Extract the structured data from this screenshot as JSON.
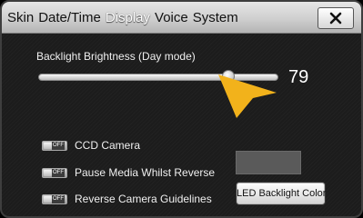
{
  "tabs": [
    {
      "label": "Skin",
      "active": false
    },
    {
      "label": "Date/Time",
      "active": false
    },
    {
      "label": "Display",
      "active": true
    },
    {
      "label": "Voice",
      "active": false
    },
    {
      "label": "System",
      "active": false
    }
  ],
  "close_icon": "close-x-icon",
  "backlight": {
    "label": "Backlight Brightness (Day mode)",
    "value": "79",
    "level_fraction": 0.79
  },
  "toggles": [
    {
      "label": "CCD Camera",
      "state": "OFF"
    },
    {
      "label": "Pause Media Whilst Reverse",
      "state": "OFF"
    },
    {
      "label": "Reverse Camera Guidelines",
      "state": "OFF"
    }
  ],
  "led_button_label": "LED Backlight Color",
  "colors": {
    "accent_cursor": "#f2b21b",
    "led_swatch": "#5a5a5a",
    "active_tab_text": "#ffffff"
  }
}
